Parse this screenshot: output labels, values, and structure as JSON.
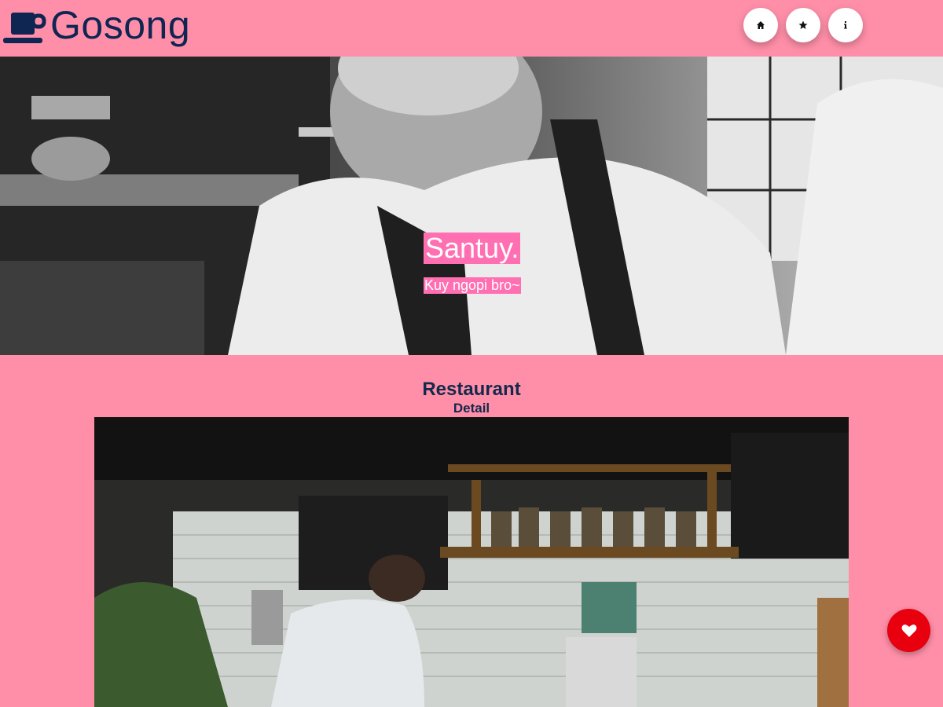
{
  "brand": {
    "name": "Gosong",
    "icon": "coffee-cup-icon",
    "color": "#0f2552"
  },
  "nav": [
    {
      "icon": "home-icon",
      "glyph": "⌂"
    },
    {
      "icon": "star-icon",
      "glyph": "★"
    },
    {
      "icon": "info-icon",
      "glyph": "i"
    }
  ],
  "hero": {
    "title": "Santuy.",
    "subtitle": "Kuy ngopi bro~",
    "highlight_color": "#ff6fb1"
  },
  "section": {
    "title": "Restaurant",
    "subtitle": "Detail"
  },
  "fab": {
    "icon": "heart-icon",
    "color": "#e8000f"
  },
  "theme": {
    "background": "#ff8fa8",
    "text": "#13294b"
  }
}
